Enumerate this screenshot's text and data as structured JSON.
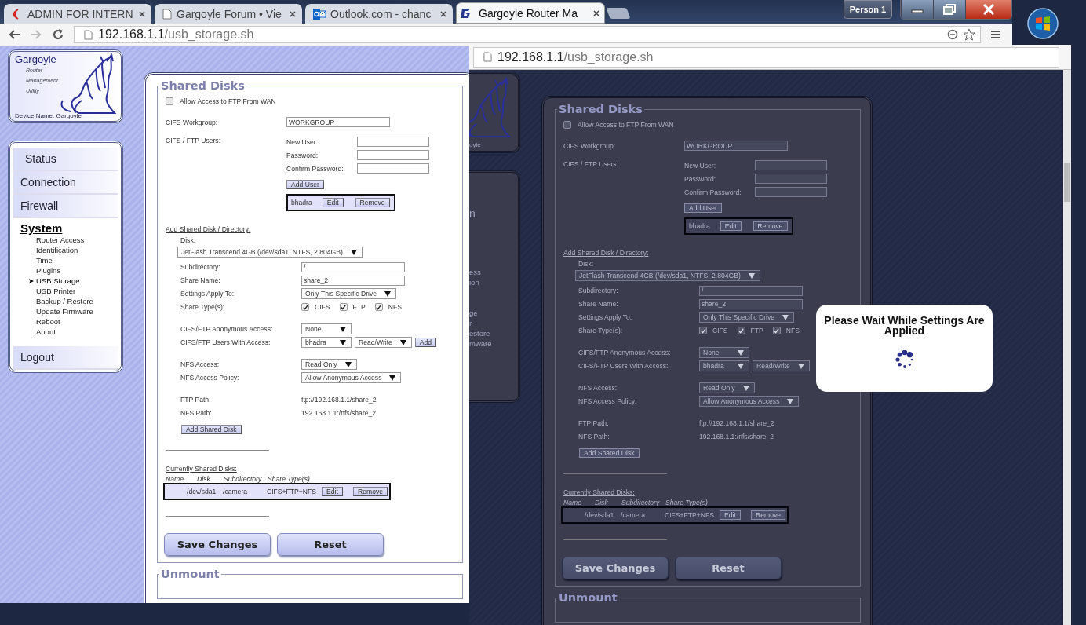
{
  "back_window": {
    "tabs": [
      {
        "kind": "signal",
        "title": "ADMIN FOR INTERN",
        "selected": false
      },
      {
        "kind": "page",
        "title": "Gargoyle Forum • Vie",
        "selected": false
      },
      {
        "kind": "mail",
        "title": "Outlook.com - chanc",
        "selected": false
      },
      {
        "kind": "gargoyle",
        "title": "Gargoyle Router Ma",
        "selected": true
      }
    ],
    "profile_button": "Person 1",
    "address": {
      "host": "192.168.1.1",
      "path": "/usb_storage.sh"
    },
    "page": {
      "logo": {
        "title": "Gargoyle",
        "subtitle": [
          "Router",
          "Management",
          "Utility"
        ],
        "device": "Device Name: Gargoyle"
      },
      "nav": [
        {
          "label": "Status",
          "selected": false
        },
        {
          "label": "Connection",
          "selected": false
        },
        {
          "label": "Firewall",
          "selected": false
        },
        {
          "label": "System",
          "selected": true,
          "children": [
            {
              "label": "Router Access",
              "selected": false
            },
            {
              "label": "Identification",
              "selected": false
            },
            {
              "label": "Time",
              "selected": false
            },
            {
              "label": "Plugins",
              "selected": false
            },
            {
              "label": "USB Storage",
              "selected": true
            },
            {
              "label": "USB Printer",
              "selected": false
            },
            {
              "label": "Backup / Restore",
              "selected": false
            },
            {
              "label": "Update Firmware",
              "selected": false
            },
            {
              "label": "Reboot",
              "selected": false
            },
            {
              "label": "About",
              "selected": false
            }
          ]
        },
        {
          "label": "Logout",
          "selected": false
        }
      ],
      "form": {
        "legend": "Shared Disks",
        "ftp_wan": {
          "label": "Allow Access to FTP From WAN",
          "checked": false
        },
        "workgroup": {
          "label": "CIFS Workgroup:",
          "value": "WORKGROUP"
        },
        "users": {
          "label": "CIFS / FTP Users:",
          "fields": [
            {
              "label": "New User:"
            },
            {
              "label": "Password:"
            },
            {
              "label": "Confirm Password:"
            }
          ],
          "add_button": "Add User",
          "entries": [
            {
              "name": "bhadra",
              "edit_button": "Edit",
              "remove_button": "Remove"
            }
          ]
        },
        "add_share": {
          "heading": "Add Shared Disk / Directory:",
          "disk_label": "Disk:",
          "disk": "JetFlash Transcend 4GB (/dev/sda1, NTFS, 2.804GB)",
          "groups": [
            [
              {
                "kind": "input",
                "label": "Subdirectory:",
                "value": "/"
              },
              {
                "kind": "input",
                "label": "Share Name:",
                "value": "share_2"
              },
              {
                "kind": "select",
                "label": "Settings Apply To:",
                "value": "Only This Specific Drive"
              },
              {
                "kind": "checks",
                "label": "Share Type(s):",
                "options": [
                  {
                    "label": "CIFS",
                    "checked": true
                  },
                  {
                    "label": "FTP",
                    "checked": true
                  },
                  {
                    "label": "NFS",
                    "checked": true
                  }
                ]
              }
            ],
            [
              {
                "kind": "select",
                "label": "CIFS/FTP Anonymous Access:",
                "value": "None"
              },
              {
                "kind": "multi",
                "label": "CIFS/FTP Users With Access:",
                "selects": [
                  "bhadra",
                  "Read/Write"
                ],
                "button": "Add"
              }
            ],
            [
              {
                "kind": "select",
                "label": "NFS Access:",
                "value": "Read Only"
              },
              {
                "kind": "select",
                "label": "NFS Access Policy:",
                "value": "Allow Anonymous Access"
              }
            ],
            [
              {
                "kind": "text",
                "label": "FTP Path:",
                "value": "ftp://192.168.1.1/share_2"
              },
              {
                "kind": "text",
                "label": "NFS Path:",
                "value": "192.168.1.1:/nfs/share_2"
              }
            ]
          ],
          "add_button": "Add Shared Disk"
        },
        "shared": {
          "heading": "Currently Shared Disks:",
          "columns": [
            "Name",
            "Disk",
            "Subdirectory",
            "Share Type(s)"
          ],
          "rows": [
            {
              "cells": [
                "",
                "/dev/sda1",
                "/camera",
                "CIFS+FTP+NFS"
              ],
              "edit_button": "Edit",
              "remove_button": "Remove"
            }
          ]
        },
        "buttons": [
          "Save Changes",
          "Reset"
        ],
        "next_legend": "Unmount"
      }
    }
  },
  "front_window": {
    "address": {
      "host": "192.168.1.1",
      "path": "/usb_storage.sh"
    },
    "page": {
      "device_fragment": "oyle",
      "nav_fragment": "n",
      "subnav_fragments": [
        "ess",
        "ion",
        "ge",
        "r",
        "estore",
        "mware"
      ],
      "form": {
        "legend": "Shared Disks",
        "ftp_wan": {
          "label": "Allow Access to FTP From WAN",
          "checked": false
        },
        "workgroup": {
          "label": "CIFS Workgroup:",
          "value": "WORKGROUP"
        },
        "users": {
          "label": "CIFS / FTP Users:",
          "fields": [
            {
              "label": "New User:"
            },
            {
              "label": "Password:"
            },
            {
              "label": "Confirm Password:"
            }
          ],
          "add_button": "Add User",
          "entries": [
            {
              "name": "bhadra",
              "edit_button": "Edit",
              "remove_button": "Remove"
            }
          ]
        },
        "add_share": {
          "heading": "Add Shared Disk / Directory:",
          "disk_label": "Disk:",
          "disk": "JetFlash Transcend 4GB (/dev/sda1, NTFS, 2.804GB)",
          "groups": [
            [
              {
                "kind": "input",
                "label": "Subdirectory:",
                "value": "/"
              },
              {
                "kind": "input",
                "label": "Share Name:",
                "value": "share_2"
              },
              {
                "kind": "select",
                "label": "Settings Apply To:",
                "value": "Only This Specific Drive"
              },
              {
                "kind": "checks",
                "label": "Share Type(s):",
                "options": [
                  {
                    "label": "CIFS",
                    "checked": true
                  },
                  {
                    "label": "FTP",
                    "checked": true
                  },
                  {
                    "label": "NFS",
                    "checked": true
                  }
                ]
              }
            ],
            [
              {
                "kind": "select",
                "label": "CIFS/FTP Anonymous Access:",
                "value": "None"
              },
              {
                "kind": "multi",
                "label": "CIFS/FTP Users With Access:",
                "selects": [
                  "bhadra",
                  "Read/Write"
                ]
              }
            ],
            [
              {
                "kind": "select",
                "label": "NFS Access:",
                "value": "Read Only"
              },
              {
                "kind": "select",
                "label": "NFS Access Policy:",
                "value": "Allow Anonymous Access"
              }
            ],
            [
              {
                "kind": "text",
                "label": "FTP Path:",
                "value": "ftp://192.168.1.1/share_2"
              },
              {
                "kind": "text",
                "label": "NFS Path:",
                "value": "192.168.1.1:/nfs/share_2"
              }
            ]
          ],
          "add_button": "Add Shared Disk"
        },
        "shared": {
          "heading": "Currently Shared Disks:",
          "columns": [
            "Name",
            "Disk",
            "Subdirectory",
            "Share Type(s)"
          ],
          "rows": [
            {
              "cells": [
                "",
                "/dev/sda1",
                "/camera",
                "CIFS+FTP+NFS"
              ],
              "edit_button": "Edit",
              "remove_button": "Remove"
            }
          ]
        },
        "buttons": [
          "Save Changes",
          "Reset"
        ],
        "next_legend": "Unmount"
      }
    },
    "dialog": {
      "title": "Please Wait While Settings Are Applied"
    }
  }
}
